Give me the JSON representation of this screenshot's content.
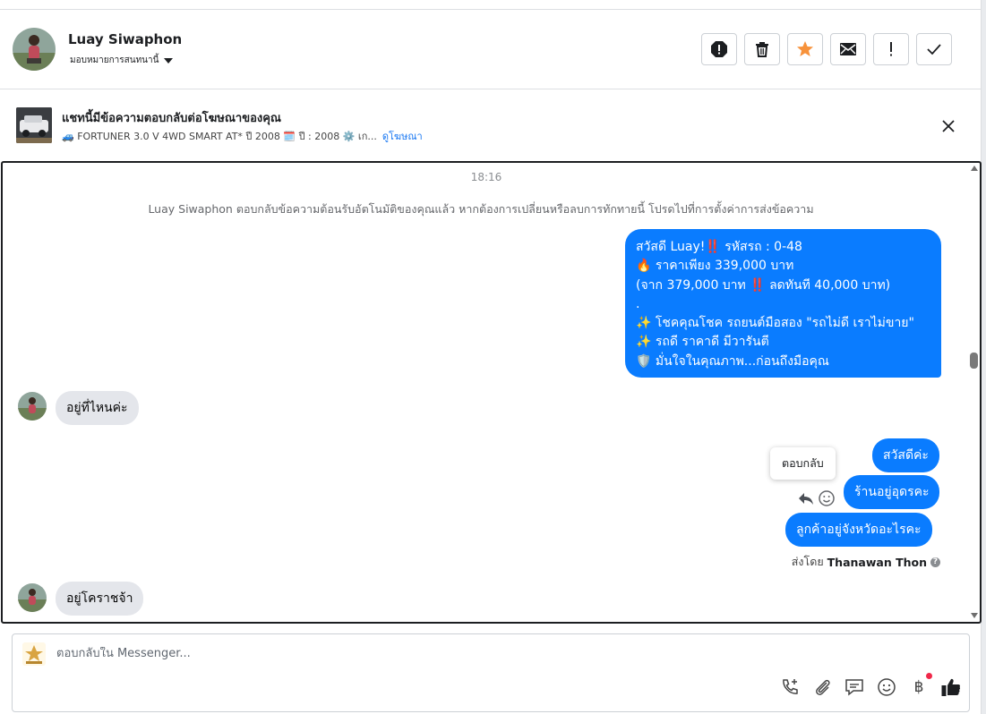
{
  "header": {
    "name": "Luay Siwaphon",
    "assign_label": "มอบหมายการสนทนานี้",
    "actions": [
      {
        "name": "spam-icon",
        "label": "spam"
      },
      {
        "name": "trash-icon",
        "label": "delete"
      },
      {
        "name": "star-icon",
        "label": "star"
      },
      {
        "name": "envelope-icon",
        "label": "unread"
      },
      {
        "name": "exclamation-icon",
        "label": "follow-up"
      },
      {
        "name": "check-icon",
        "label": "done"
      }
    ],
    "star_color": "#f7923b"
  },
  "ad": {
    "title": "แชทนี้มีข้อความตอบกลับต่อโฆษณาของคุณ",
    "subtitle": "🚙 FORTUNER 3.0 V 4WD SMART AT* ปี 2008 🗓️ ปี : 2008 ⚙️ เก...",
    "link": "ดูโฆษณา"
  },
  "conversation": {
    "timestamp": "18:16",
    "system_note": "Luay Siwaphon ตอบกลับข้อความต้อนรับอัตโนมัติของคุณแล้ว หากต้องการเปลี่ยนหรือลบการทักทายนี้ โปรดไปที่การตั้งค่าการส่งข้อความ",
    "outgoing_main": [
      "สวัสดี Luay!‼️ รหัสรถ : 0-48",
      "🔥 ราคาเพียง 339,000 บาท",
      "(จาก 379,000 บาท ‼️ ลดทันที 40,000 บาท)",
      ".",
      "✨ โชคคุณโชค รถยนต์มือสอง \"รถไม่ดี เราไม่ขาย\"",
      "✨ รถดี ราคาดี มีวารันตี",
      "🛡️ มั่นใจในคุณภาพ...ก่อนถึงมือคุณ"
    ],
    "incoming_1": "อยู่ที่ไหนค่ะ",
    "outgoing_1": "สวัสดีค่ะ",
    "outgoing_2": "ร้านอยู่อุดรคะ",
    "outgoing_3": "ลูกค้าอยู่จังหวัดอะไรคะ",
    "tooltip": "ตอบกลับ",
    "sent_by_prefix": "ส่งโดย",
    "sent_by_name": "Thanawan Thon",
    "help_glyph": "?",
    "incoming_2": "อยู่โคราชจ้า",
    "bubble_color": "#0a7cff"
  },
  "composer": {
    "placeholder": "ตอบกลับใน Messenger...",
    "tools": [
      "phone-add-icon",
      "paperclip-icon",
      "chat-bubble-icon",
      "emoji-icon",
      "baht-icon",
      "thumbs-up-icon"
    ],
    "baht_glyph": "฿"
  }
}
